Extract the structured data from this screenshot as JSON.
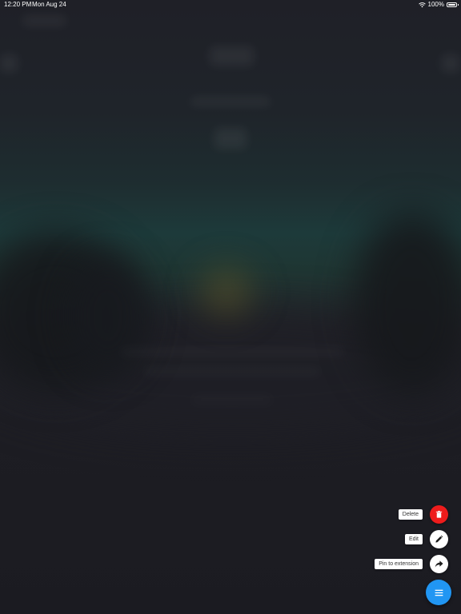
{
  "status_bar": {
    "time": "12:20 PM",
    "date": "Mon Aug 24",
    "battery_percent": "100%"
  },
  "fab_menu": {
    "items": [
      {
        "label": "Delete",
        "icon": "trash-icon",
        "color": "#ee1c1c"
      },
      {
        "label": "Edit",
        "icon": "pencil-icon",
        "color": "#ffffff"
      },
      {
        "label": "Pin to extension",
        "icon": "share-arrow-icon",
        "color": "#ffffff"
      }
    ],
    "main_button": {
      "icon": "menu-icon",
      "color": "#2196f3"
    }
  }
}
